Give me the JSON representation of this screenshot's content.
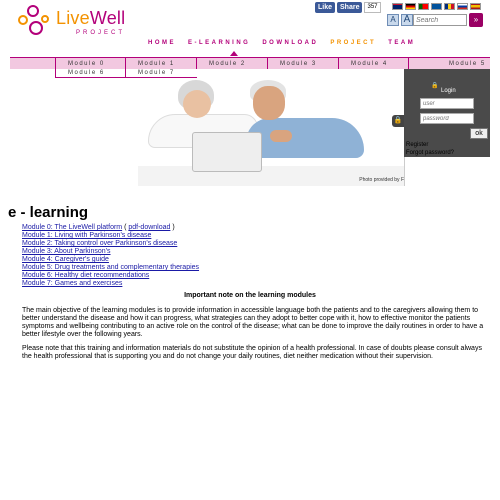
{
  "header": {
    "logo_text_a": "Live",
    "logo_text_b": "Well",
    "logo_sub": "PROJECT",
    "fb_like": "Like",
    "fb_share": "Share",
    "fb_count": "357",
    "search_placeholder": "Search",
    "search_go": "»",
    "font_small": "A",
    "font_large": "A"
  },
  "nav": {
    "items": [
      "HOME",
      "E-LEARNING",
      "DOWNLOAD",
      "PROJECT",
      "TEAM"
    ]
  },
  "modules_bar": {
    "row1": [
      "Module 0",
      "Module 1",
      "Module 2",
      "Module 3",
      "Module 4",
      "Module 5"
    ],
    "row2": [
      "Module 6",
      "Module 7"
    ]
  },
  "hero": {
    "credit": "Photo provided by F"
  },
  "login": {
    "title": "Login",
    "lock": "🔒",
    "user_placeholder": "user",
    "password_placeholder": "password",
    "ok": "ok",
    "register": "Register",
    "forgot": "Forgot password?",
    "tab_icon": "🔒"
  },
  "content": {
    "title": "e - learning",
    "links": [
      {
        "label": "Module 0: The LiveWell platform",
        "extra_open": " ( ",
        "extra_link": "pdf-download",
        "extra_close": " )"
      },
      {
        "label": "Module 1: Living with Parkinson's disease"
      },
      {
        "label": "Module 2: Taking control over Parkinson's disease"
      },
      {
        "label": "Module 3: About Parkinson's"
      },
      {
        "label": "Module 4: Caregiver's guide"
      },
      {
        "label": "Module 5: Drug treatments and complementary therapies"
      },
      {
        "label": "Module 6: Healthy diet recommendations"
      },
      {
        "label": "Module 7: Games and exercises"
      }
    ],
    "note_title": "Important note on the learning modules",
    "para1": "The main objective of the learning modules is to provide information in accessible language both the patients and to the caregivers allowing them to better understand the disease and how it can progress, what strategies can they adopt to better cope with it, how to effective monitor the patients symptoms and wellbeing contributing to an active role on the control of the disease; what can be done to improve the daily routines in order to have a better lifestyle over the following years.",
    "para2": "Please note that this training and information materials do not substitute the opinion of a health professional. In case of doubts please consult always the health professional that is supporting you and do not change your daily routines, diet neither medication without their supervision."
  },
  "colors": {
    "brand_magenta": "#b3007a",
    "brand_orange": "#f39200",
    "module_bar": "#f2c8e0",
    "link_blue": "#1a1aa6"
  }
}
